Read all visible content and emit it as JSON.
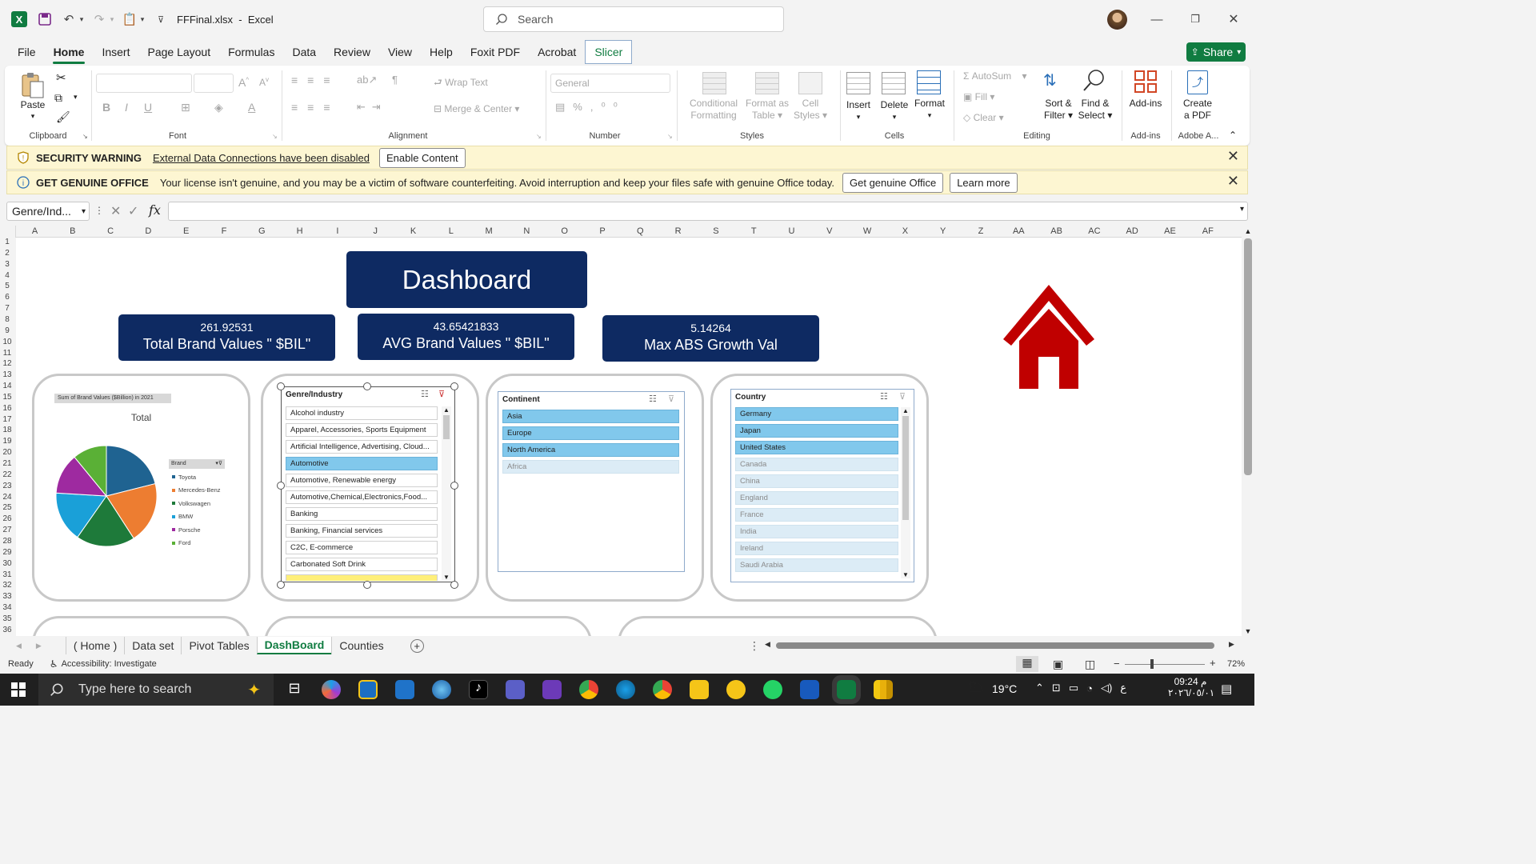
{
  "app": {
    "filename": "FFFinal.xlsx",
    "name": "Excel",
    "search_placeholder": "Search"
  },
  "menu": {
    "items": [
      "File",
      "Home",
      "Insert",
      "Page Layout",
      "Formulas",
      "Data",
      "Review",
      "View",
      "Help",
      "Foxit PDF",
      "Acrobat",
      "Slicer"
    ],
    "share": "Share"
  },
  "ribbon": {
    "clipboard": {
      "paste": "Paste",
      "label": "Clipboard"
    },
    "font": {
      "label": "Font"
    },
    "alignment": {
      "wrap": "Wrap Text",
      "merge": "Merge & Center",
      "label": "Alignment"
    },
    "number": {
      "format": "General",
      "label": "Number"
    },
    "styles": {
      "cond1": "Conditional",
      "cond2": "Formatting",
      "fmt1": "Format as",
      "fmt2": "Table",
      "cell1": "Cell",
      "cell2": "Styles",
      "label": "Styles"
    },
    "cells": {
      "insert": "Insert",
      "delete": "Delete",
      "format": "Format",
      "label": "Cells"
    },
    "editing": {
      "autosum": "AutoSum",
      "fill": "Fill",
      "clear": "Clear",
      "sort1": "Sort &",
      "sort2": "Filter",
      "find1": "Find &",
      "find2": "Select",
      "label": "Editing"
    },
    "addins": {
      "btn": "Add-ins",
      "label": "Add-ins"
    },
    "adobe": {
      "btn1": "Create",
      "btn2": "a PDF",
      "label": "Adobe A..."
    }
  },
  "security_bar": {
    "title": "SECURITY WARNING",
    "message": "External Data Connections have been disabled",
    "button": "Enable Content"
  },
  "genuine_bar": {
    "title": "GET GENUINE OFFICE",
    "message": "Your license isn't genuine, and you may be a victim of software counterfeiting. Avoid interruption and keep your files safe with genuine Office today.",
    "button1": "Get genuine Office",
    "button2": "Learn more"
  },
  "formula_bar": {
    "name_box": "Genre/Ind...",
    "fx": "fx"
  },
  "columns": [
    "A",
    "B",
    "C",
    "D",
    "E",
    "F",
    "G",
    "H",
    "I",
    "J",
    "K",
    "L",
    "M",
    "N",
    "O",
    "P",
    "Q",
    "R",
    "S",
    "T",
    "U",
    "V",
    "W",
    "X",
    "Y",
    "Z",
    "AA",
    "AB",
    "AC",
    "AD",
    "AE",
    "AF"
  ],
  "rows": [
    "1",
    "2",
    "3",
    "4",
    "5",
    "6",
    "7",
    "8",
    "9",
    "10",
    "11",
    "12",
    "13",
    "14",
    "15",
    "16",
    "17",
    "18",
    "19",
    "20",
    "21",
    "22",
    "23",
    "24",
    "25",
    "26",
    "27",
    "28",
    "29",
    "30",
    "31",
    "32",
    "33",
    "34",
    "35",
    "36"
  ],
  "dashboard": {
    "title": "Dashboard",
    "kpis": [
      {
        "value": "261.92531",
        "label": "Total Brand Values \" $BIL\""
      },
      {
        "value": "43.65421833",
        "label": "AVG Brand Values \" $BIL\""
      },
      {
        "value": "5.14264",
        "label": "Max ABS Growth Val"
      }
    ],
    "home_color": "#c00000"
  },
  "chart_data": {
    "type": "pie",
    "title": "Total",
    "field_button": "Sum of Brand Values ($Billion) in 2021",
    "legend_title": "Brand",
    "categories": [
      "Toyota",
      "Mercedes-Benz",
      "Volkswagen",
      "BMW",
      "Porsche",
      "Ford"
    ],
    "values": [
      54.1,
      50.9,
      48.5,
      41.6,
      33.7,
      28.1
    ],
    "colors": [
      "#1f6391",
      "#ed7d31",
      "#1e7a3a",
      "#1aa0d8",
      "#9e2aa0",
      "#5ab036"
    ],
    "legend_position": "right"
  },
  "slicers": {
    "genre": {
      "title": "Genre/Industry",
      "items": [
        {
          "t": "Alcohol industry",
          "s": "n"
        },
        {
          "t": "Apparel, Accessories, Sports Equipment",
          "s": "n"
        },
        {
          "t": "Artificial Intelligence, Advertising, Cloud...",
          "s": "n"
        },
        {
          "t": "Automotive",
          "s": "sel"
        },
        {
          "t": "Automotive, Renewable energy",
          "s": "n"
        },
        {
          "t": "Automotive,Chemical,Electronics,Food...",
          "s": "n"
        },
        {
          "t": "Banking",
          "s": "n"
        },
        {
          "t": "Banking, Financial services",
          "s": "n"
        },
        {
          "t": "C2C, E-commerce",
          "s": "n"
        },
        {
          "t": "Carbonated Soft Drink",
          "s": "n"
        }
      ]
    },
    "continent": {
      "title": "Continent",
      "items": [
        {
          "t": "Asia",
          "s": "sel"
        },
        {
          "t": "Europe",
          "s": "sel"
        },
        {
          "t": "North America",
          "s": "sel"
        },
        {
          "t": "Africa",
          "s": "un"
        }
      ]
    },
    "country": {
      "title": "Country",
      "items": [
        {
          "t": "Germany",
          "s": "sel"
        },
        {
          "t": "Japan",
          "s": "sel"
        },
        {
          "t": "United States",
          "s": "sel"
        },
        {
          "t": "Canada",
          "s": "un"
        },
        {
          "t": "China",
          "s": "un"
        },
        {
          "t": "England",
          "s": "un"
        },
        {
          "t": "France",
          "s": "un"
        },
        {
          "t": "India",
          "s": "un"
        },
        {
          "t": "Ireland",
          "s": "un"
        },
        {
          "t": "Saudi Arabia",
          "s": "un"
        }
      ]
    }
  },
  "sheet_tabs": [
    "( Home )",
    "Data set",
    "Pivot Tables",
    "DashBoard",
    "Counties"
  ],
  "status": {
    "ready": "Ready",
    "accessibility": "Accessibility: Investigate",
    "zoom": "72%"
  },
  "taskbar": {
    "search": "Type here to search",
    "temp": "19°C",
    "time": "09:24 م",
    "date": "٢٠٢٦/٠٥/٠١",
    "lang": "ع"
  }
}
